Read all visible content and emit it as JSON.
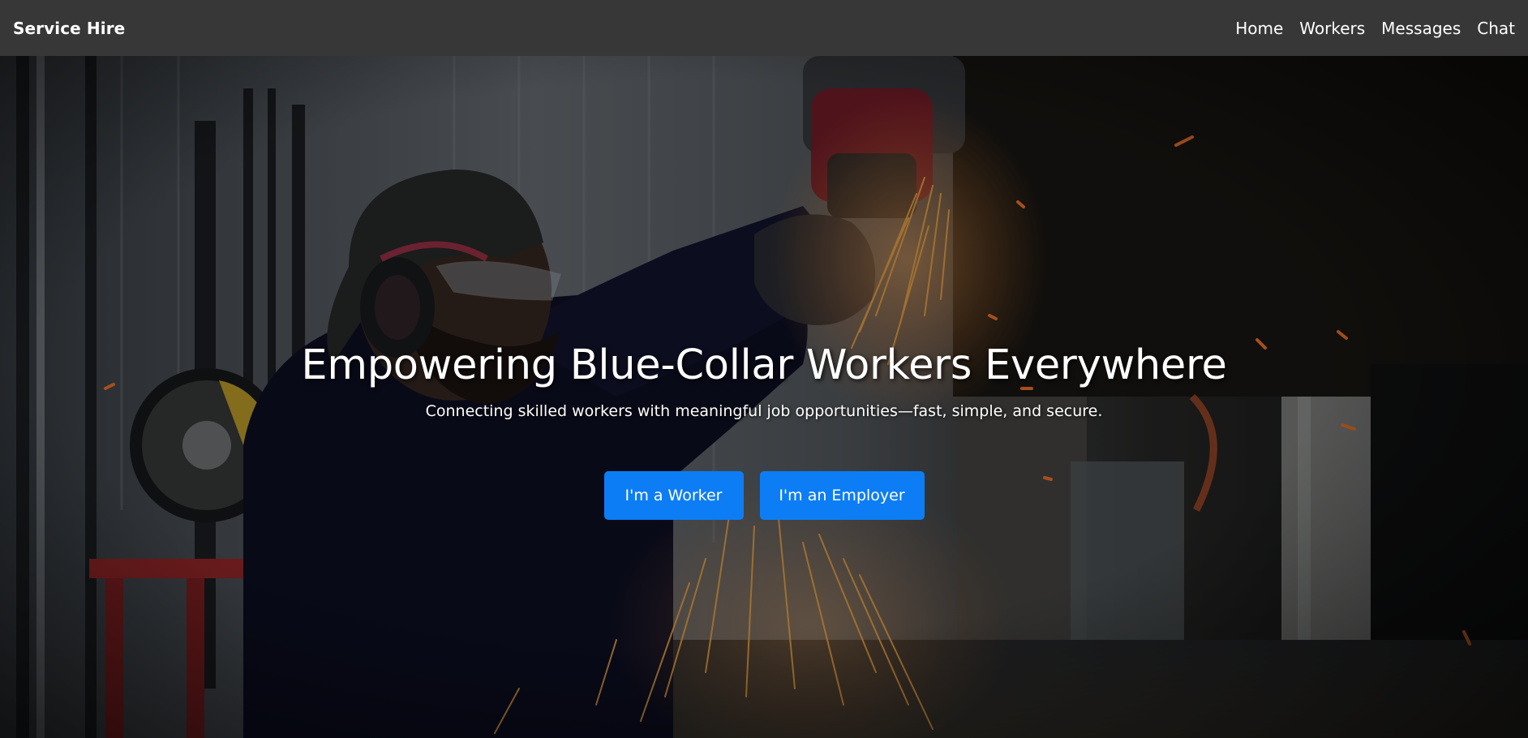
{
  "nav": {
    "brand": "Service Hire",
    "links": [
      {
        "label": "Home"
      },
      {
        "label": "Workers"
      },
      {
        "label": "Messages"
      },
      {
        "label": "Chat"
      }
    ]
  },
  "hero": {
    "title": "Empowering Blue-Collar Workers Everywhere",
    "subtitle": "Connecting skilled workers with meaningful job opportunities—fast, simple, and secure.",
    "buttons": [
      {
        "label": "I'm a Worker"
      },
      {
        "label": "I'm an Employer"
      }
    ],
    "background": "photo of a worker wearing a cap, ear protection and safety glasses using an angle grinder with sparks in a workshop",
    "accent_color": "#0d7df5",
    "navbar_color": "#373737"
  }
}
